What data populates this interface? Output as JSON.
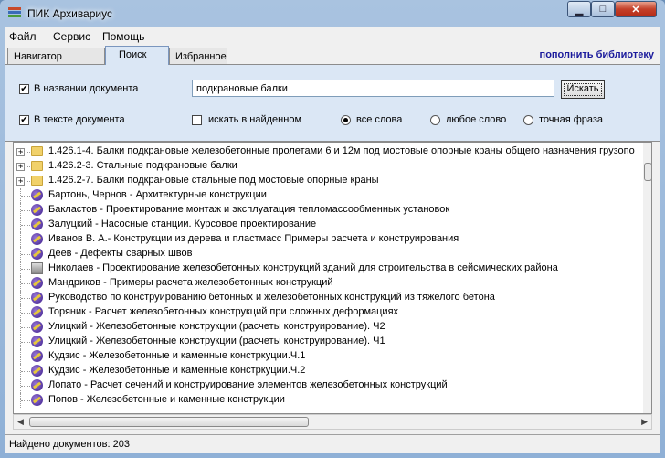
{
  "window": {
    "title": "ПИК Архивариус"
  },
  "menu": [
    "Файл",
    "Сервис",
    "Помощь"
  ],
  "tabs": [
    {
      "label": "Навигатор",
      "active": false
    },
    {
      "label": "Поиск",
      "active": true
    },
    {
      "label": "Избранное",
      "active": false
    }
  ],
  "replenish_link": "пополнить библиотеку",
  "search": {
    "in_title_label": "В названии документа",
    "in_title_checked": true,
    "in_text_label": "В тексте документа",
    "in_text_checked": true,
    "in_found_label": "искать в найденном",
    "in_found_checked": false,
    "query": "подкрановые балки",
    "button": "Искать",
    "mode_all": "все слова",
    "mode_any": "любое слово",
    "mode_exact": "точная фраза",
    "selected_mode": "все слова"
  },
  "results": [
    {
      "icon": "folder",
      "text": "1.426.1-4. Балки подкрановые железобетонные пролетами 6 и 12м под мостовые опорные краны общего назначения грузопо"
    },
    {
      "icon": "folder",
      "text": "1.426.2-3. Стальные подкрановые балки"
    },
    {
      "icon": "folder",
      "text": "1.426.2-7. Балки подкрановые стальные под мостовые опорные краны"
    },
    {
      "icon": "book",
      "text": "Бартонь, Чернов - Архитектурные конструкции"
    },
    {
      "icon": "book",
      "text": "Бакластов - Проектирование монтаж и эксплуатация тепломассообменных установок"
    },
    {
      "icon": "book",
      "text": "Залуцкий - Насосные станции. Курсовое проектирование"
    },
    {
      "icon": "book",
      "text": "Иванов В. А.- Конструкции из дерева и пластмасс Примеры расчета и конструирования"
    },
    {
      "icon": "book",
      "text": "Деев - Дефекты сварных швов"
    },
    {
      "icon": "generic",
      "text": "Николаев - Проектирование железобетонных конструкций зданий для строительства в сейсмических района"
    },
    {
      "icon": "book",
      "text": "Мандриков - Примеры расчета железобетонных конструкций"
    },
    {
      "icon": "book",
      "text": "Руководство по конструированию бетонных и  железобетонных конструкций из тяжелого бетона"
    },
    {
      "icon": "book",
      "text": "Торяник - Расчет железобетонных конструкций при сложных деформациях"
    },
    {
      "icon": "book",
      "text": "Улицкий - Железобетонные конструкции (расчеты конструирование). Ч2"
    },
    {
      "icon": "book",
      "text": "Улицкий - Железобетонные конструкции (расчеты конструирование). Ч1"
    },
    {
      "icon": "book",
      "text": "Кудзис - Железобетонные и каменные констркуции.Ч.1"
    },
    {
      "icon": "book",
      "text": "Кудзис - Железобетонные и каменные констркуции.Ч.2"
    },
    {
      "icon": "book",
      "text": "Лопато - Расчет сечений и конструирование элементов железобетонных конструкций"
    },
    {
      "icon": "book",
      "text": "Попов - Железобетонные и каменные конструкции"
    }
  ],
  "status": "Найдено документов: 203"
}
